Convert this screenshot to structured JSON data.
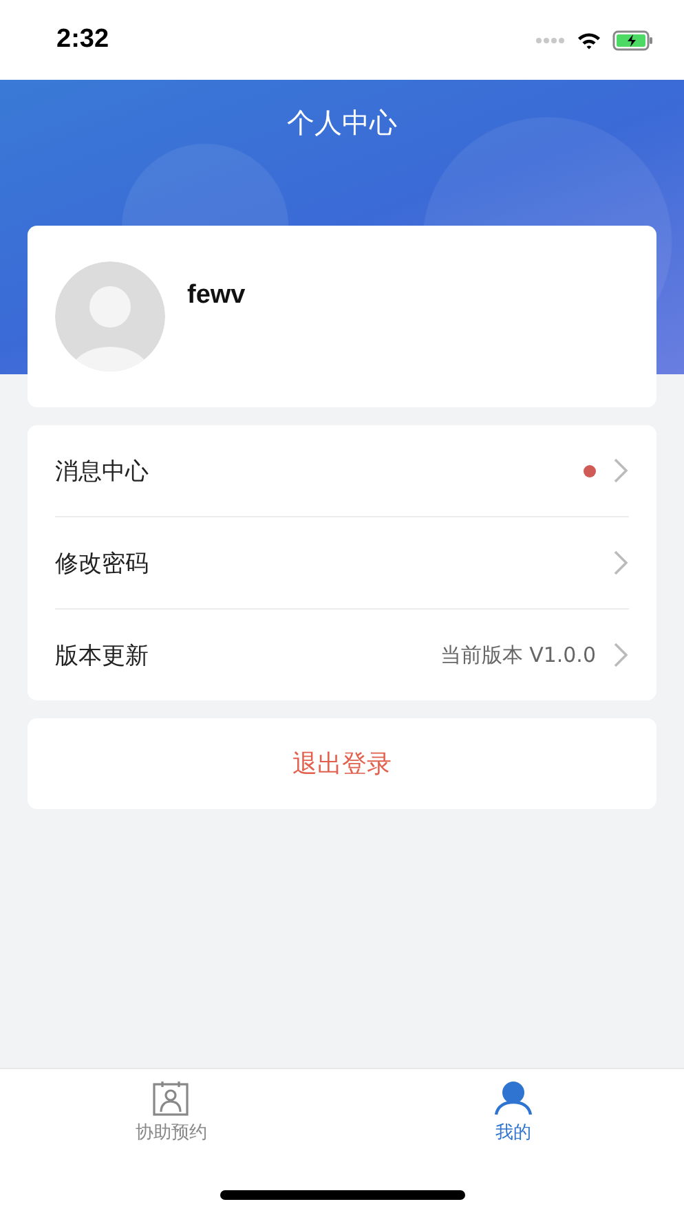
{
  "status_bar": {
    "time": "2:32"
  },
  "header": {
    "title": "个人中心"
  },
  "profile": {
    "name": "fewv"
  },
  "menu": [
    {
      "label": "消息中心",
      "dot": true
    },
    {
      "label": "修改密码",
      "dot": false
    },
    {
      "label": "版本更新",
      "dot": false,
      "value": "当前版本 V1.0.0"
    }
  ],
  "logout": {
    "label": "退出登录"
  },
  "tab_bar": [
    {
      "label": "协助预约",
      "kind": "calendar",
      "selected": false
    },
    {
      "label": "我的",
      "kind": "person",
      "selected": true
    }
  ]
}
